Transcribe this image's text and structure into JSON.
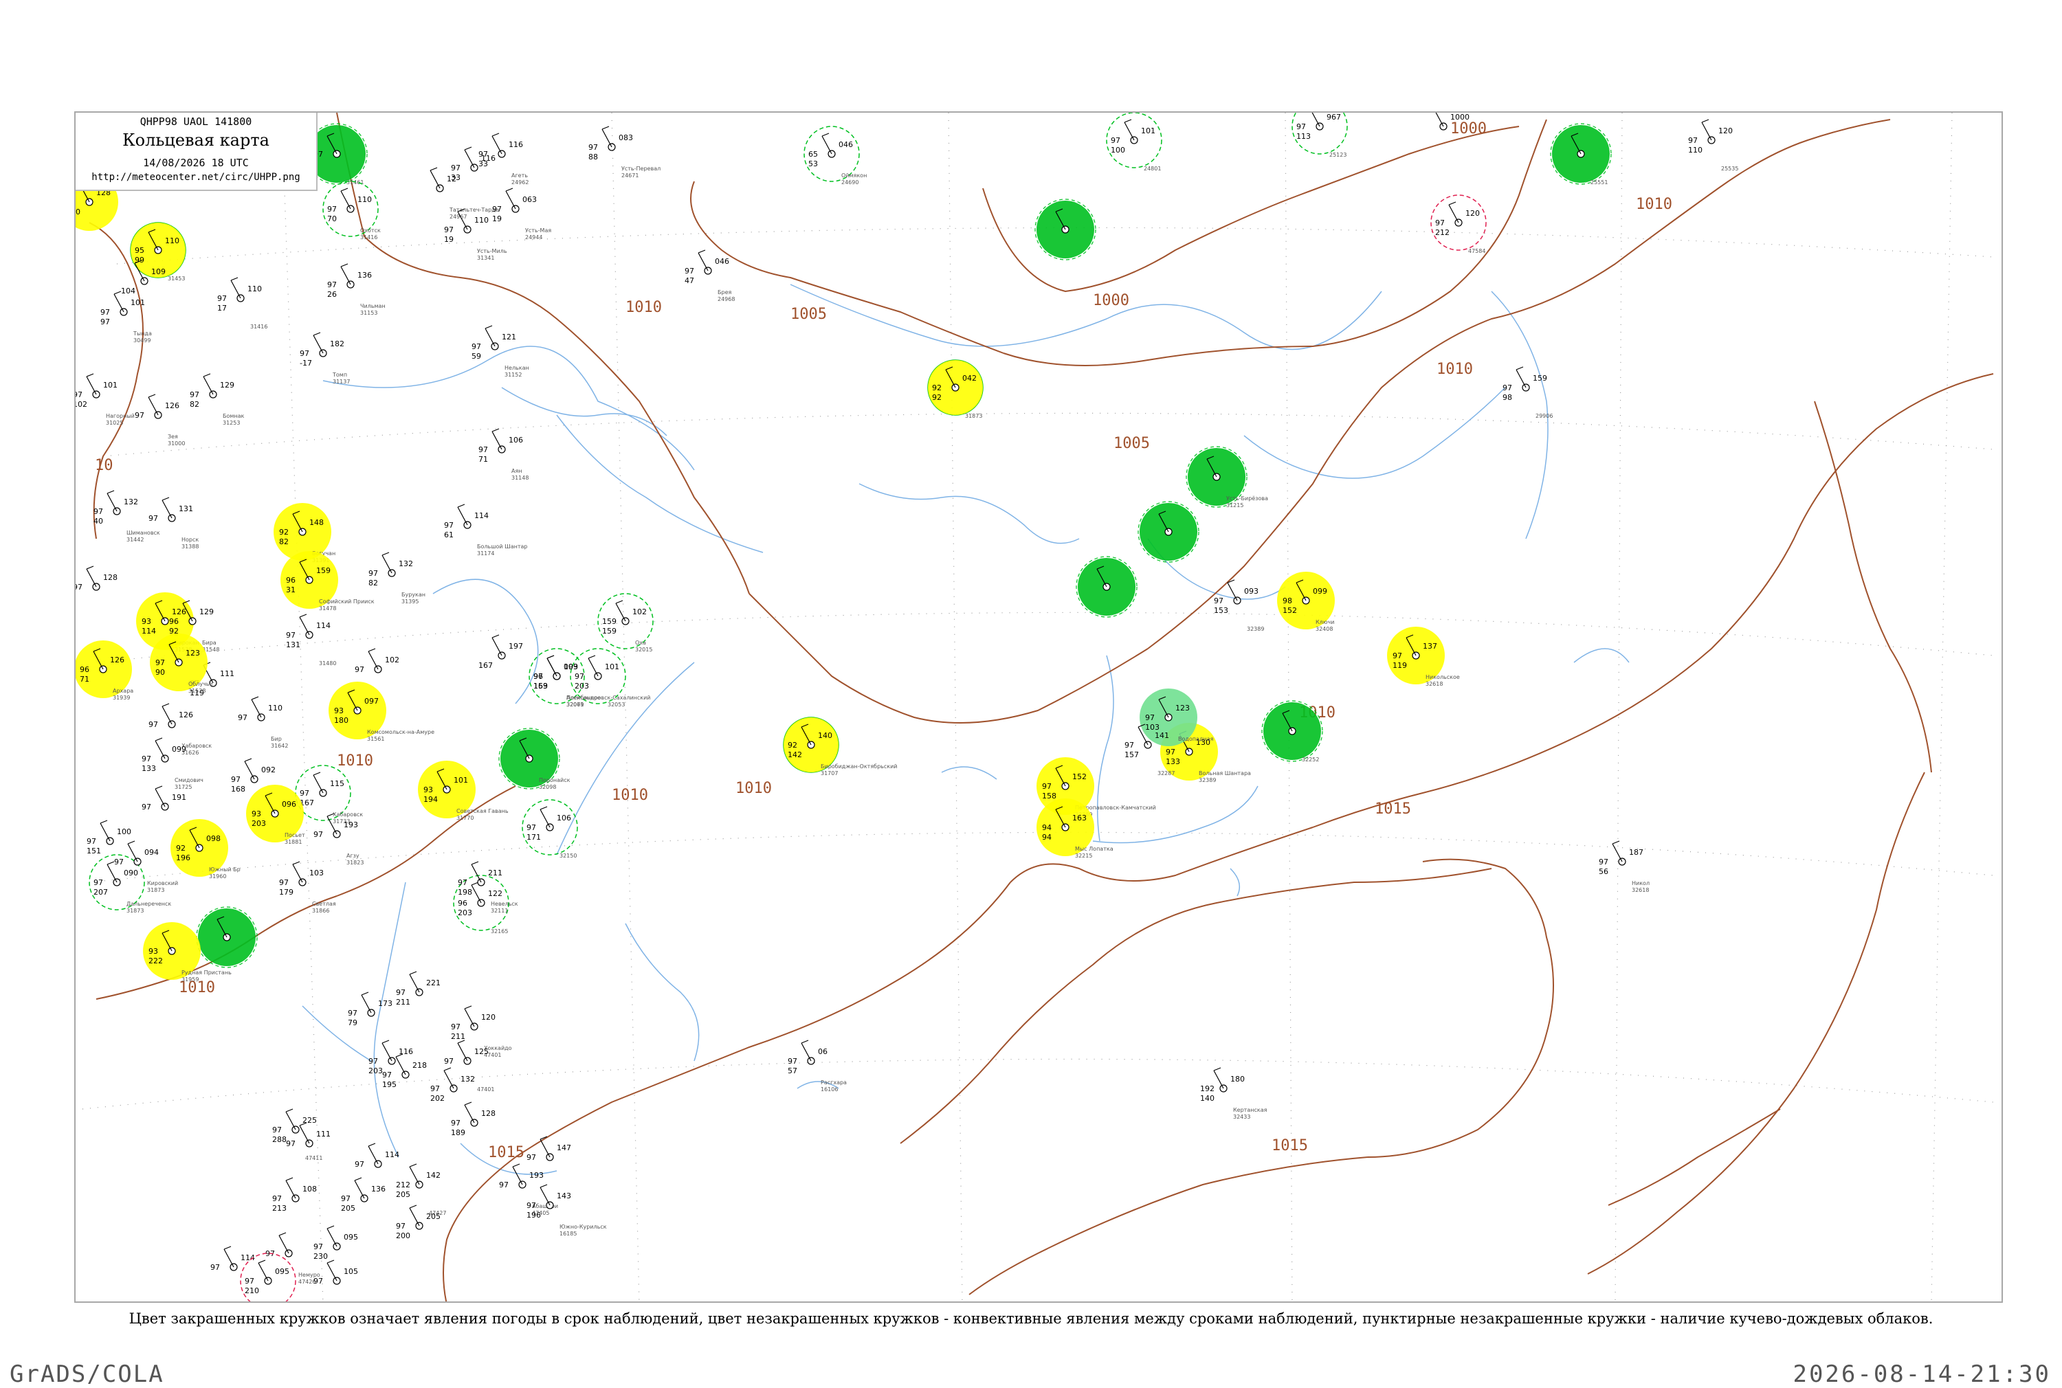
{
  "header": {
    "code": "QHPP98  UAOL  141800",
    "title": "Кольцевая карта",
    "datetime": "14/08/2026 18 UTC",
    "url": "http://meteocenter.net/circ/UHPP.png"
  },
  "legend_note": "Цвет закрашенных кружков означает явления погоды в срок наблюдений, цвет незакрашенных кружков - конвективные явления между сроками наблюдений, пунктирные незакрашенные кружки - наличие кучево-дождевых облаков.",
  "footer": {
    "left": "GrADS/COLA",
    "right": "2026-08-14-21:30"
  },
  "colors": {
    "isobar": "#a0522d",
    "river": "#7fb3e6",
    "rain": "#00c020",
    "fog": "#ffff00",
    "light_rain": "#70e090",
    "thunder": "#e02050",
    "graticule": "#9a9a9a"
  },
  "isobar_labels": [
    "1000",
    "1010",
    "1000",
    "1010",
    "1005",
    "1010",
    "1005",
    "1010",
    "1010",
    "1015",
    "1010",
    "1010",
    "10",
    "1015",
    "1015",
    "1010"
  ],
  "stations": [
    {
      "kind": "rain",
      "p": "",
      "t": "97",
      "d": "",
      "idx": "31461",
      "name": ""
    },
    {
      "kind": "fog",
      "p": "128",
      "t": "97",
      "d": "100",
      "idx": "",
      "name": ""
    },
    {
      "kind": "rain-ring",
      "p": "110",
      "t": "97",
      "d": "70",
      "idx": "31416",
      "name": "Охотск"
    },
    {
      "kind": "plain",
      "p": "116",
      "t": "97",
      "d": "33",
      "idx": "",
      "name": ""
    },
    {
      "kind": "plain",
      "p": "12",
      "t": "",
      "d": "",
      "idx": "24967",
      "name": "Татальтеч-Тарде"
    },
    {
      "kind": "plain",
      "p": "116",
      "t": "97",
      "d": "33",
      "idx": "24962",
      "name": "Агеть"
    },
    {
      "kind": "plain",
      "p": "083",
      "t": "97",
      "d": "88",
      "idx": "24671",
      "name": "Усть-Перевал"
    },
    {
      "kind": "rain-ring",
      "p": "046",
      "t": "65",
      "d": "53",
      "idx": "24690",
      "name": "Оймякон"
    },
    {
      "kind": "rain-ring",
      "p": "101",
      "t": "97",
      "d": "100",
      "idx": "24801",
      "name": ""
    },
    {
      "kind": "rain-ring",
      "p": "967",
      "t": "97",
      "d": "113",
      "idx": "25123",
      "name": ""
    },
    {
      "kind": "plain",
      "p": "1000",
      "t": "",
      "d": "",
      "idx": "",
      "name": ""
    },
    {
      "kind": "rain",
      "p": "",
      "t": "",
      "d": "",
      "idx": "25551",
      "name": ""
    },
    {
      "kind": "plain",
      "p": "120",
      "t": "97",
      "d": "110",
      "idx": "25535",
      "name": ""
    },
    {
      "kind": "fog-ring",
      "p": "110",
      "t": "95",
      "d": "99",
      "idx": "31453",
      "name": ""
    },
    {
      "kind": "plain",
      "p": "109",
      "t": "",
      "d": "104",
      "idx": "",
      "name": ""
    },
    {
      "kind": "plain",
      "p": "110",
      "t": "97",
      "d": "17",
      "idx": "31416",
      "name": ""
    },
    {
      "kind": "plain",
      "p": "063",
      "t": "97",
      "d": "19",
      "idx": "24944",
      "name": "Усть-Мая"
    },
    {
      "kind": "plain",
      "p": "110",
      "t": "97",
      "d": "19",
      "idx": "31341",
      "name": "Усть-Миль"
    },
    {
      "kind": "plain",
      "p": "136",
      "t": "97",
      "d": "26",
      "idx": "31153",
      "name": "Чильман"
    },
    {
      "kind": "plain",
      "p": "101",
      "t": "97",
      "d": "97",
      "idx": "30499",
      "name": "Тында"
    },
    {
      "kind": "plain",
      "p": "046",
      "t": "97",
      "d": "47",
      "idx": "24968",
      "name": "Брея"
    },
    {
      "kind": "rain",
      "p": "",
      "t": "",
      "d": "",
      "idx": "",
      "name": ""
    },
    {
      "kind": "plain",
      "p": "182",
      "t": "97",
      "d": "-17",
      "idx": "31137",
      "name": "Томп"
    },
    {
      "kind": "plain",
      "p": "121",
      "t": "97",
      "d": "59",
      "idx": "31152",
      "name": "Нелькан"
    },
    {
      "kind": "fog-ring",
      "p": "042",
      "t": "92",
      "d": "92",
      "idx": "31873",
      "name": ""
    },
    {
      "kind": "plain",
      "p": "129",
      "t": "97",
      "d": "82",
      "idx": "31253",
      "name": "Бомнак"
    },
    {
      "kind": "plain",
      "p": "101",
      "t": "97",
      "d": "102",
      "idx": "31025",
      "name": "Нагорный"
    },
    {
      "kind": "plain",
      "p": "126",
      "t": "97",
      "d": "",
      "idx": "31000",
      "name": "Зея"
    },
    {
      "kind": "plain",
      "p": "106",
      "t": "97",
      "d": "71",
      "idx": "31148",
      "name": "Аян"
    },
    {
      "kind": "rain",
      "p": "",
      "t": "",
      "d": "",
      "idx": "31215",
      "name": "Усть-Бирёзова"
    },
    {
      "kind": "plain",
      "p": "159",
      "t": "97",
      "d": "98",
      "idx": "29906",
      "name": ""
    },
    {
      "kind": "plain",
      "p": "132",
      "t": "97",
      "d": "40",
      "idx": "31442",
      "name": "Шимановск"
    },
    {
      "kind": "plain",
      "p": "131",
      "t": "97",
      "d": "",
      "idx": "31388",
      "name": "Норск"
    },
    {
      "kind": "fog",
      "p": "148",
      "t": "92",
      "d": "82",
      "idx": "31391",
      "name": "Богучан"
    },
    {
      "kind": "plain",
      "p": "114",
      "t": "97",
      "d": "61",
      "idx": "31174",
      "name": "Большой Шантар"
    },
    {
      "kind": "rain",
      "p": "",
      "t": "",
      "d": "",
      "idx": "",
      "name": ""
    },
    {
      "kind": "rain",
      "p": "",
      "t": "",
      "d": "",
      "idx": "",
      "name": ""
    },
    {
      "kind": "fog",
      "p": "159",
      "t": "96",
      "d": "31",
      "idx": "31478",
      "name": "Софийский Прииск"
    },
    {
      "kind": "plain",
      "p": "132",
      "t": "97",
      "d": "82",
      "idx": "31395",
      "name": "Бурукан"
    },
    {
      "kind": "plain",
      "p": "093",
      "t": "97",
      "d": "153",
      "idx": "32389",
      "name": ""
    },
    {
      "kind": "fog",
      "p": "099",
      "t": "98",
      "d": "152",
      "idx": "32408",
      "name": "Ключи"
    },
    {
      "kind": "fog",
      "p": "137",
      "t": "97",
      "d": "119",
      "idx": "32618",
      "name": "Никольское"
    },
    {
      "kind": "plain",
      "p": "128",
      "t": "97",
      "d": "",
      "idx": "",
      "name": ""
    },
    {
      "kind": "fog",
      "p": "126",
      "t": "93",
      "d": "114",
      "idx": "31538",
      "name": "Бирокан"
    },
    {
      "kind": "plain",
      "p": "129",
      "t": "96",
      "d": "92",
      "idx": "31548",
      "name": "Бира"
    },
    {
      "kind": "plain",
      "p": "111",
      "t": "97",
      "d": "119",
      "idx": "",
      "name": ""
    },
    {
      "kind": "rain-ring",
      "p": "102",
      "t": "159",
      "d": "159",
      "idx": "32015",
      "name": "Оха"
    },
    {
      "kind": "plain",
      "p": "197",
      "t": "",
      "d": "167",
      "idx": "",
      "name": ""
    },
    {
      "kind": "fog",
      "p": "126",
      "t": "96",
      "d": "71",
      "idx": "31939",
      "name": "Архара"
    },
    {
      "kind": "fog",
      "p": "123",
      "t": "97",
      "d": "90",
      "idx": "31538",
      "name": "Облучье"
    },
    {
      "kind": "plain",
      "p": "114",
      "t": "97",
      "d": "131",
      "idx": "31480",
      "name": ""
    },
    {
      "kind": "plain",
      "p": "102",
      "t": "97",
      "d": "",
      "idx": "",
      "name": ""
    },
    {
      "kind": "rain-ring",
      "p": "099",
      "t": "96",
      "d": "169",
      "idx": "32061",
      "name": "Александровск-Сахалинский"
    },
    {
      "kind": "rain-ring",
      "p": "101",
      "t": "97",
      "d": "203",
      "idx": "32053",
      "name": ""
    },
    {
      "kind": "fog",
      "p": "097",
      "t": "93",
      "d": "180",
      "idx": "31561",
      "name": "Комсомольск-на-Амуре"
    },
    {
      "kind": "plain",
      "p": "110",
      "t": "97",
      "d": "",
      "idx": "31642",
      "name": "Бир"
    },
    {
      "kind": "plain",
      "p": "126",
      "t": "97",
      "d": "",
      "idx": "31626",
      "name": "Хабаровск"
    },
    {
      "kind": "plain",
      "p": "099",
      "t": "97",
      "d": "133",
      "idx": "31725",
      "name": "Смидович"
    },
    {
      "kind": "fog-ring",
      "p": "140",
      "t": "92",
      "d": "142",
      "idx": "31707",
      "name": "Биробиджан-Октябрьский"
    },
    {
      "kind": "plain",
      "p": "092",
      "t": "97",
      "d": "168",
      "idx": "",
      "name": ""
    },
    {
      "kind": "rain-ring",
      "p": "115",
      "t": "97",
      "d": "167",
      "idx": "31733",
      "name": "Хабаровск"
    },
    {
      "kind": "fog",
      "p": "101",
      "t": "93",
      "d": "194",
      "idx": "31770",
      "name": "Советская Гавань"
    },
    {
      "kind": "rain",
      "p": "",
      "t": "",
      "d": "",
      "idx": "32098",
      "name": "Поронайск"
    },
    {
      "kind": "plain",
      "p": "103",
      "t": "97",
      "d": "153",
      "idx": "32079",
      "name": "Погибоьное"
    },
    {
      "kind": "rain",
      "p": "",
      "t": "",
      "d": "",
      "idx": "32252",
      "name": ""
    },
    {
      "kind": "fog",
      "p": "130",
      "t": "97",
      "d": "133",
      "idx": "32389",
      "name": "Вольная Шантара"
    },
    {
      "kind": "fog",
      "p": "152",
      "t": "97",
      "d": "158",
      "idx": "32389",
      "name": "Петропавловск-Камчатский"
    },
    {
      "kind": "light-rain",
      "p": "123",
      "t": "97",
      "d": "103",
      "idx": "",
      "name": "Водопадная"
    },
    {
      "kind": "plain",
      "p": "141",
      "t": "97",
      "d": "157",
      "idx": "32287",
      "name": ""
    },
    {
      "kind": "fog",
      "p": "163",
      "t": "94",
      "d": "94",
      "idx": "32215",
      "name": "Мыс Лопатка"
    },
    {
      "kind": "fog",
      "p": "096",
      "t": "93",
      "d": "203",
      "idx": "31881",
      "name": "Посьет"
    },
    {
      "kind": "fog",
      "p": "098",
      "t": "92",
      "d": "196",
      "idx": "31960",
      "name": "Южный Бр"
    },
    {
      "kind": "rain-ring",
      "p": "090",
      "t": "97",
      "d": "207",
      "idx": "31873",
      "name": "Дальнереченск"
    },
    {
      "kind": "plain",
      "p": "094",
      "t": "97",
      "d": "",
      "idx": "31873",
      "name": "Кировский"
    },
    {
      "kind": "plain",
      "p": "100",
      "t": "97",
      "d": "151",
      "idx": "",
      "name": ""
    },
    {
      "kind": "rain-ring",
      "p": "106",
      "t": "97",
      "d": "171",
      "idx": "32150",
      "name": ""
    },
    {
      "kind": "plain",
      "p": "193",
      "t": "97",
      "d": "",
      "idx": "31823",
      "name": "Агзу"
    },
    {
      "kind": "plain",
      "p": "191",
      "t": "97",
      "d": "",
      "idx": "",
      "name": ""
    },
    {
      "kind": "plain",
      "p": "103",
      "t": "97",
      "d": "179",
      "idx": "31866",
      "name": "Светлая"
    },
    {
      "kind": "rain-ring",
      "p": "122",
      "t": "96",
      "d": "203",
      "idx": "32165",
      "name": ""
    },
    {
      "kind": "plain",
      "p": "211",
      "t": "97",
      "d": "198",
      "idx": "32111",
      "name": "Невельск"
    },
    {
      "kind": "rain",
      "p": "",
      "t": "",
      "d": "",
      "idx": "",
      "name": ""
    },
    {
      "kind": "fog",
      "p": "",
      "t": "93",
      "d": "222",
      "idx": "31959",
      "name": "Рудная Пристань"
    },
    {
      "kind": "plain",
      "p": "187",
      "t": "97",
      "d": "56",
      "idx": "32618",
      "name": "Никол"
    },
    {
      "kind": "plain",
      "p": "221",
      "t": "97",
      "d": "211",
      "idx": "",
      "name": ""
    },
    {
      "kind": "plain",
      "p": "120",
      "t": "97",
      "d": "211",
      "idx": "47401",
      "name": "Хоккайдо"
    },
    {
      "kind": "plain",
      "p": "173",
      "t": "97",
      "d": "79",
      "idx": "",
      "name": ""
    },
    {
      "kind": "plain",
      "p": "125",
      "t": "97",
      "d": "",
      "idx": "47401",
      "name": ""
    },
    {
      "kind": "plain",
      "p": "116",
      "t": "97",
      "d": "203",
      "idx": "",
      "name": ""
    },
    {
      "kind": "plain",
      "p": "218",
      "t": "97",
      "d": "195",
      "idx": "",
      "name": ""
    },
    {
      "kind": "plain",
      "p": "132",
      "t": "97",
      "d": "202",
      "idx": "",
      "name": ""
    },
    {
      "kind": "plain",
      "p": "128",
      "t": "97",
      "d": "189",
      "idx": "",
      "name": ""
    },
    {
      "kind": "plain",
      "p": "06",
      "t": "97",
      "d": "57",
      "idx": "16106",
      "name": "Расгхара"
    },
    {
      "kind": "plain",
      "p": "180",
      "t": "192",
      "d": "140",
      "idx": "32433",
      "name": "Кертанская"
    },
    {
      "kind": "plain",
      "p": "225",
      "t": "97",
      "d": "288",
      "idx": "47411",
      "name": ""
    },
    {
      "kind": "plain",
      "p": "111",
      "t": "97",
      "d": "",
      "idx": "",
      "name": ""
    },
    {
      "kind": "plain",
      "p": "114",
      "t": "97",
      "d": "",
      "idx": "",
      "name": ""
    },
    {
      "kind": "plain",
      "p": "136",
      "t": "97",
      "d": "205",
      "idx": "",
      "name": ""
    },
    {
      "kind": "plain",
      "p": "142",
      "t": "212",
      "d": "205",
      "idx": "47427",
      "name": ""
    },
    {
      "kind": "plain",
      "p": "193",
      "t": "97",
      "d": "",
      "idx": "47405",
      "name": "Абашири"
    },
    {
      "kind": "plain",
      "p": "147",
      "t": "97",
      "d": "",
      "idx": "",
      "name": ""
    },
    {
      "kind": "plain",
      "p": "143",
      "t": "97",
      "d": "196",
      "idx": "16185",
      "name": "Южно-Курильск"
    },
    {
      "kind": "plain",
      "p": "108",
      "t": "97",
      "d": "213",
      "idx": "",
      "name": ""
    },
    {
      "kind": "plain",
      "p": "205",
      "t": "97",
      "d": "200",
      "idx": "",
      "name": ""
    },
    {
      "kind": "plain",
      "p": "",
      "t": "97",
      "d": "",
      "idx": "47426",
      "name": "Немуро"
    },
    {
      "kind": "plain",
      "p": "095",
      "t": "97",
      "d": "230",
      "idx": "",
      "name": ""
    },
    {
      "kind": "plain",
      "p": "105",
      "t": "97",
      "d": "",
      "idx": "",
      "name": ""
    },
    {
      "kind": "plain",
      "p": "114",
      "t": "97",
      "d": "",
      "idx": "",
      "name": ""
    },
    {
      "kind": "thunder-ring",
      "p": "095",
      "t": "97",
      "d": "210",
      "idx": "47574",
      "name": ""
    },
    {
      "kind": "thunder-ring",
      "p": "120",
      "t": "97",
      "d": "212",
      "idx": "47584",
      "name": ""
    }
  ]
}
